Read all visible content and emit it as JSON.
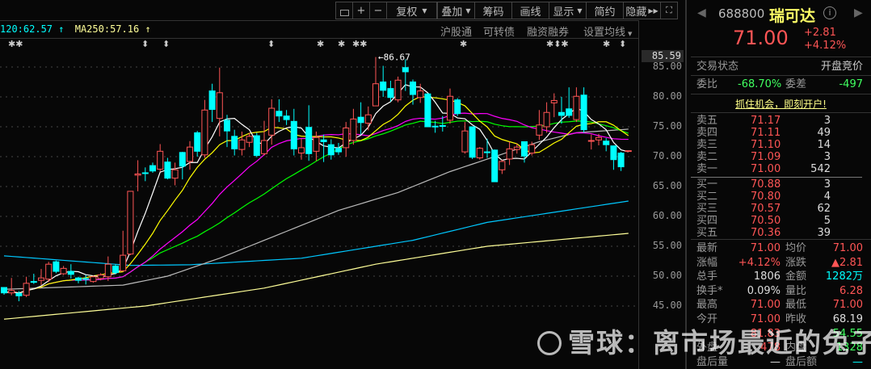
{
  "toolbar": {
    "lock": "lock-icon",
    "plus": "+",
    "minus": "−",
    "fuquan": "复权",
    "diejia": "叠加",
    "chouma": "筹码",
    "huaxian": "画线",
    "xianshi": "显示",
    "jianyue": "简约",
    "yincang": "隐藏",
    "fullscreen": "fullscreen-icon"
  },
  "tags": {
    "hgt": "沪股通",
    "kzz": "可转债",
    "rzrq": "融资融券",
    "sjx": "设置均线"
  },
  "legend": {
    "ma120": "120:62.57",
    "ma250": "MA250:57.16",
    "up": "↑"
  },
  "axis": {
    "current": "85.59",
    "ticks": [
      "85.00",
      "80.00",
      "75.00",
      "70.00",
      "65.00",
      "60.00",
      "55.00",
      "50.00",
      "45.00"
    ],
    "max_label": "86.67"
  },
  "colors": {
    "up": "#ff5555",
    "down": "#00ffff",
    "ma5": "#ffffff",
    "ma10": "#ffff00",
    "ma20": "#ff00ff",
    "ma30": "#00ff00",
    "ma60": "#bbbbbb",
    "ma120": "#00c8ff",
    "ma250": "#ffff99"
  },
  "chart_data": {
    "type": "candlestick",
    "ylim": [
      45,
      85
    ],
    "candles": [
      [
        48.1,
        47.2,
        48.1,
        46.9
      ],
      [
        47.2,
        47.6,
        49.7,
        46.8
      ],
      [
        47.1,
        46.7,
        47.5,
        45.8
      ],
      [
        46.8,
        48.8,
        49.9,
        46.5
      ],
      [
        49.1,
        49.0,
        50.4,
        48.7
      ],
      [
        49.3,
        49.7,
        51.2,
        48.5
      ],
      [
        49.5,
        52.0,
        52.4,
        49.0
      ],
      [
        52.4,
        50.8,
        52.6,
        50.5
      ],
      [
        50.4,
        51.3,
        51.7,
        50.2
      ],
      [
        50.8,
        50.3,
        52.0,
        49.6
      ],
      [
        49.7,
        49.3,
        49.9,
        48.8
      ],
      [
        49.6,
        49.5,
        50.2,
        48.6
      ],
      [
        49.1,
        49.9,
        50.1,
        48.9
      ],
      [
        49.6,
        50.2,
        50.5,
        49.3
      ],
      [
        49.9,
        52.0,
        53.3,
        49.2
      ],
      [
        51.7,
        50.6,
        52.0,
        50.3
      ],
      [
        50.9,
        53.5,
        57.6,
        50.7
      ],
      [
        53.7,
        64.2,
        64.2,
        53.5
      ],
      [
        66.9,
        67.1,
        69.4,
        64.2
      ],
      [
        67.3,
        67.2,
        68.2,
        65.9
      ],
      [
        68.5,
        67.6,
        69.0,
        67.3
      ],
      [
        67.9,
        70.9,
        72.1,
        67.5
      ],
      [
        69.1,
        66.4,
        69.8,
        66.2
      ],
      [
        66.4,
        67.8,
        69.0,
        65.2
      ],
      [
        70.7,
        68.4,
        70.8,
        66.2
      ],
      [
        69.2,
        71.6,
        72.6,
        67.8
      ],
      [
        74.0,
        70.9,
        74.3,
        70.0
      ],
      [
        70.3,
        77.8,
        79.5,
        69.8
      ],
      [
        81.0,
        77.9,
        82.2,
        75.8
      ],
      [
        76.4,
        80.7,
        84.9,
        73.4
      ],
      [
        76.1,
        74.3,
        77.0,
        71.6
      ],
      [
        73.4,
        71.3,
        74.5,
        70.2
      ],
      [
        71.2,
        72.8,
        74.2,
        70.2
      ],
      [
        72.4,
        73.4,
        74.0,
        71.6
      ],
      [
        73.5,
        70.2,
        74.0,
        69.9
      ],
      [
        70.5,
        72.7,
        76.0,
        70.2
      ],
      [
        73.6,
        78.1,
        79.6,
        72.0
      ],
      [
        77.6,
        76.8,
        79.6,
        75.8
      ],
      [
        76.8,
        76.2,
        77.8,
        75.3
      ],
      [
        75.9,
        71.3,
        78.0,
        70.2
      ],
      [
        70.6,
        71.5,
        73.0,
        69.5
      ],
      [
        74.9,
        70.5,
        78.6,
        69.3
      ],
      [
        70.9,
        73.2,
        74.2,
        69.3
      ],
      [
        72.8,
        72.5,
        73.7,
        69.1
      ],
      [
        72.0,
        70.3,
        72.9,
        69.5
      ],
      [
        71.4,
        70.8,
        72.3,
        70.3
      ],
      [
        71.5,
        74.8,
        75.8,
        70.0
      ],
      [
        72.7,
        76.3,
        78.0,
        72.0
      ],
      [
        76.6,
        75.7,
        79.1,
        73.7
      ],
      [
        75.6,
        77.0,
        78.4,
        74.4
      ],
      [
        78.5,
        82.2,
        86.67,
        78.5
      ],
      [
        82.5,
        81.1,
        85.2,
        80.0
      ],
      [
        81.4,
        79.9,
        82.7,
        79.2
      ],
      [
        79.5,
        82.8,
        83.4,
        79.1
      ],
      [
        84.9,
        84.2,
        86.3,
        81.0
      ],
      [
        82.5,
        80.4,
        82.9,
        78.7
      ],
      [
        79.9,
        81.0,
        82.2,
        79.0
      ],
      [
        80.5,
        75.0,
        80.6,
        75.0
      ],
      [
        75.1,
        75.0,
        76.0,
        74.0
      ],
      [
        75.2,
        75.1,
        76.8,
        74.2
      ],
      [
        76.1,
        80.1,
        81.4,
        75.5
      ],
      [
        79.5,
        77.2,
        79.8,
        76.8
      ],
      [
        70.8,
        74.3,
        75.8,
        70.5
      ],
      [
        75.0,
        69.9,
        75.0,
        69.6
      ],
      [
        69.8,
        71.4,
        71.6,
        69.5
      ],
      [
        70.8,
        70.7,
        73.0,
        69.8
      ],
      [
        71.1,
        65.8,
        71.2,
        65.8
      ],
      [
        67.8,
        69.2,
        69.5,
        67.1
      ],
      [
        69.6,
        71.3,
        72.5,
        68.6
      ],
      [
        71.2,
        71.6,
        72.2,
        70.5
      ],
      [
        72.5,
        70.1,
        72.5,
        69.0
      ],
      [
        70.6,
        72.0,
        72.5,
        70.2
      ],
      [
        73.6,
        75.3,
        77.8,
        72.8
      ],
      [
        75.0,
        77.4,
        79.1,
        74.0
      ],
      [
        79.0,
        79.4,
        80.6,
        76.6
      ],
      [
        77.4,
        76.9,
        80.0,
        75.5
      ],
      [
        78.0,
        76.9,
        81.6,
        76.5
      ],
      [
        76.2,
        80.1,
        81.6,
        75.8
      ],
      [
        80.3,
        74.5,
        81.6,
        74.0
      ],
      [
        72.6,
        72.7,
        73.7,
        71.2
      ],
      [
        72.8,
        73.2,
        73.8,
        71.9
      ],
      [
        72.6,
        72.0,
        73.1,
        70.9
      ],
      [
        71.8,
        69.5,
        71.8,
        67.8
      ],
      [
        70.6,
        68.3,
        70.8,
        67.6
      ],
      [
        71.0,
        71.0,
        71.0,
        71.0
      ]
    ],
    "ma60_points": [
      [
        0,
        47.8
      ],
      [
        16,
        48.5
      ],
      [
        22,
        50
      ],
      [
        29,
        53
      ],
      [
        37,
        57
      ],
      [
        45,
        61
      ],
      [
        53,
        64
      ],
      [
        60,
        67.5
      ],
      [
        66,
        70
      ],
      [
        72,
        72.5
      ],
      [
        77,
        74
      ],
      [
        84,
        74.6
      ]
    ],
    "ma120_points": [
      [
        0,
        53.4
      ],
      [
        17,
        51.8
      ],
      [
        25,
        51.9
      ],
      [
        40,
        53
      ],
      [
        55,
        56
      ],
      [
        65,
        59
      ],
      [
        84,
        62.57
      ]
    ],
    "ma250_points": [
      [
        0,
        42.8
      ],
      [
        19,
        45
      ],
      [
        35,
        48
      ],
      [
        50,
        52
      ],
      [
        65,
        55
      ],
      [
        84,
        57.16
      ]
    ]
  },
  "quote": {
    "code": "688800",
    "name": "瑞可达",
    "price": "71.00",
    "change": "+2.81",
    "pct": "+4.12%",
    "prev": "◀",
    "next": "▶",
    "info": "i"
  },
  "status": {
    "label": "交易状态",
    "value": "开盘竞价"
  },
  "weibi": {
    "label": "委比",
    "value": "-68.70%",
    "diff_label": "委差",
    "diff": "-497"
  },
  "banner": "抓住机会，即刻开户!",
  "asks": [
    {
      "l": "卖五",
      "p": "71.17",
      "v": "3"
    },
    {
      "l": "卖四",
      "p": "71.11",
      "v": "49"
    },
    {
      "l": "卖三",
      "p": "71.10",
      "v": "14"
    },
    {
      "l": "卖二",
      "p": "71.09",
      "v": "3"
    },
    {
      "l": "卖一",
      "p": "71.00",
      "v": "542"
    }
  ],
  "bids": [
    {
      "l": "买一",
      "p": "70.88",
      "v": "3"
    },
    {
      "l": "买二",
      "p": "70.80",
      "v": "4"
    },
    {
      "l": "买三",
      "p": "70.57",
      "v": "62"
    },
    {
      "l": "买四",
      "p": "70.50",
      "v": "5"
    },
    {
      "l": "买五",
      "p": "70.36",
      "v": "39"
    }
  ],
  "stats": [
    {
      "l1": "最新",
      "v1": "71.00",
      "c1": "red",
      "l2": "均价",
      "v2": "71.00",
      "c2": "red"
    },
    {
      "l1": "涨幅",
      "v1": "+4.12%",
      "c1": "red",
      "l2": "涨跌",
      "v2": "▲2.81",
      "c2": "red"
    },
    {
      "l1": "总手",
      "v1": "1806",
      "c1": "wh",
      "l2": "金额",
      "v2": "1282万",
      "c2": "cy"
    },
    {
      "l1": "换手*",
      "v1": "0.09%",
      "c1": "wh",
      "l2": "量比",
      "v2": "6.28",
      "c2": "red"
    },
    {
      "l1": "最高",
      "v1": "71.00",
      "c1": "red",
      "l2": "最低",
      "v2": "71.00",
      "c2": "red"
    },
    {
      "l1": "今开",
      "v1": "71.00",
      "c1": "red",
      "l2": "昨收",
      "v2": "68.19",
      "c2": "wh"
    },
    {
      "l1": "",
      "v1": "81.83",
      "c1": "red",
      "l2": "",
      "v2": "54.55",
      "c2": "grn"
    },
    {
      "l1": "外盘",
      "v1": "478",
      "c1": "red",
      "l2": "内盘",
      "v2": "1328",
      "c2": "grn"
    },
    {
      "l1": "盘后量",
      "v1": "—",
      "c1": "wh",
      "l2": "盘后额",
      "v2": "—",
      "c2": "cy"
    }
  ],
  "watermark": "雪球：离市场最近的兔子"
}
